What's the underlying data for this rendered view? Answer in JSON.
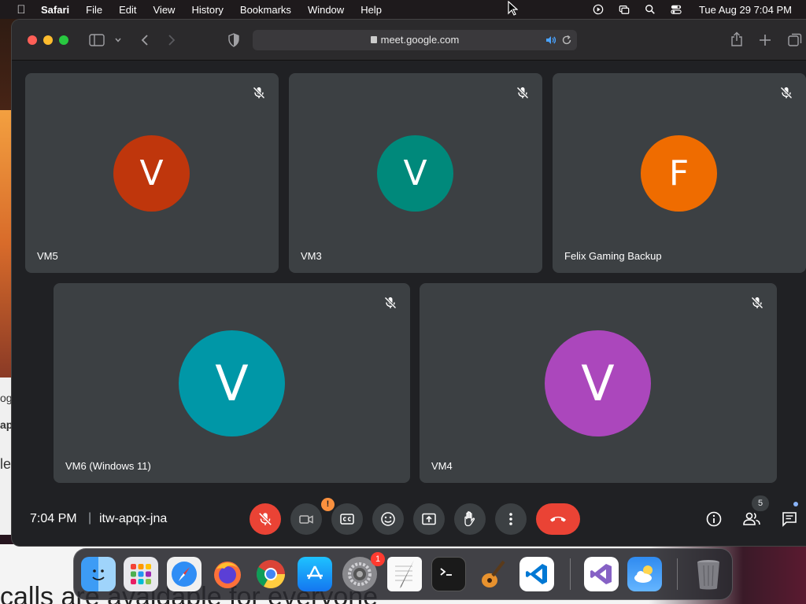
{
  "menubar": {
    "app": "Safari",
    "items": [
      "File",
      "Edit",
      "View",
      "History",
      "Bookmarks",
      "Window",
      "Help"
    ],
    "clock": "Tue Aug 29  7:04 PM"
  },
  "browser": {
    "url": "meet.google.com"
  },
  "meet": {
    "participants": [
      {
        "name": "VM5",
        "initial": "V",
        "color": "#bf360c"
      },
      {
        "name": "VM3",
        "initial": "V",
        "color": "#00897b"
      },
      {
        "name": "Felix Gaming Backup",
        "initial": "F",
        "color": "#ef6c00"
      },
      {
        "name": "VM6 (Windows 11)",
        "initial": "V",
        "color": "#0097a7"
      },
      {
        "name": "VM4",
        "initial": "V",
        "color": "#ab47bc"
      }
    ],
    "time": "7:04 PM",
    "separator": "|",
    "meeting_code": "itw-apqx-jna",
    "people_count": "5",
    "camera_warning": "!"
  },
  "dock": {
    "settings_badge": "1",
    "apps": [
      "finder-icon",
      "launchpad-icon",
      "safari-icon",
      "firefox-icon",
      "chrome-icon",
      "app-store-icon",
      "system-settings-icon",
      "textedit-icon",
      "terminal-icon",
      "garageband-icon",
      "vscode-icon",
      "visual-studio-icon",
      "weather-icon",
      "trash-icon"
    ]
  },
  "background": {
    "fragment_1": "ogl",
    "fragment_2": "app",
    "fragment_3": "le",
    "bottom_text": "calls are avaidable for everyone"
  }
}
